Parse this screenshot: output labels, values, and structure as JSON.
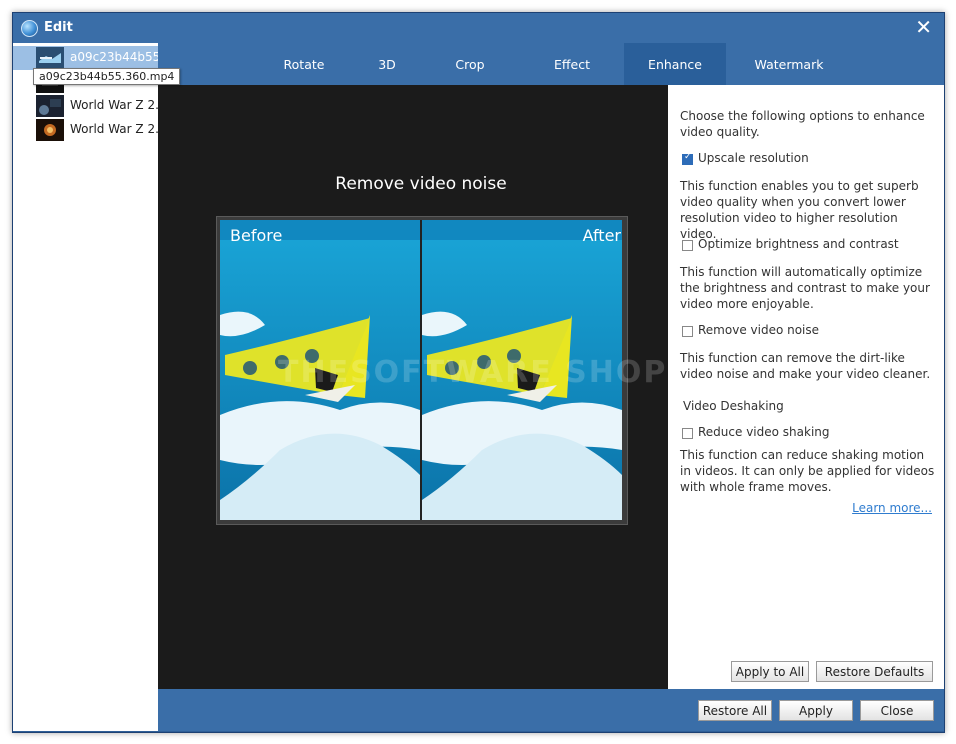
{
  "window": {
    "title": "Edit",
    "close_glyph": "✕"
  },
  "sidebar": {
    "items": [
      {
        "label": "a09c23b44b55.",
        "selected": true
      },
      {
        "label": "World War Z 2."
      },
      {
        "label": "World War Z 2."
      },
      {
        "label": "World War Z 2."
      }
    ],
    "tooltip": "a09c23b44b55.360.mp4"
  },
  "tabs": [
    {
      "label": "Rotate"
    },
    {
      "label": "3D"
    },
    {
      "label": "Crop"
    },
    {
      "label": "Effect"
    },
    {
      "label": "Enhance",
      "active": true
    },
    {
      "label": "Watermark"
    }
  ],
  "preview": {
    "title": "Remove video noise",
    "before_label": "Before",
    "after_label": "After",
    "watermark": "THESOFTWARE SHOP"
  },
  "enhance": {
    "intro": "Choose the following options to enhance video quality.",
    "options": [
      {
        "label": "Upscale resolution",
        "checked": true,
        "description": "This function enables you to get superb video quality when you convert lower resolution video to higher resolution video."
      },
      {
        "label": "Optimize brightness and contrast",
        "checked": false,
        "description": "This function will automatically optimize the brightness and contrast to make your video more enjoyable."
      },
      {
        "label": "Remove video noise",
        "checked": false,
        "description": "This function can remove the dirt-like video noise and make your video cleaner."
      }
    ],
    "deshake_heading": "Video Deshaking",
    "deshake": {
      "label": "Reduce video shaking",
      "checked": false,
      "description": "This function can reduce shaking motion in videos. It can only be applied for videos with whole frame moves."
    },
    "learn_more": "Learn more...",
    "apply_all": "Apply to All",
    "restore_defaults": "Restore Defaults"
  },
  "footer": {
    "restore_all": "Restore All",
    "apply": "Apply",
    "close": "Close"
  },
  "colors": {
    "frame_blue": "#3a6ea8",
    "accent": "#2f7ccf",
    "preview_bg": "#1b1b1b"
  }
}
